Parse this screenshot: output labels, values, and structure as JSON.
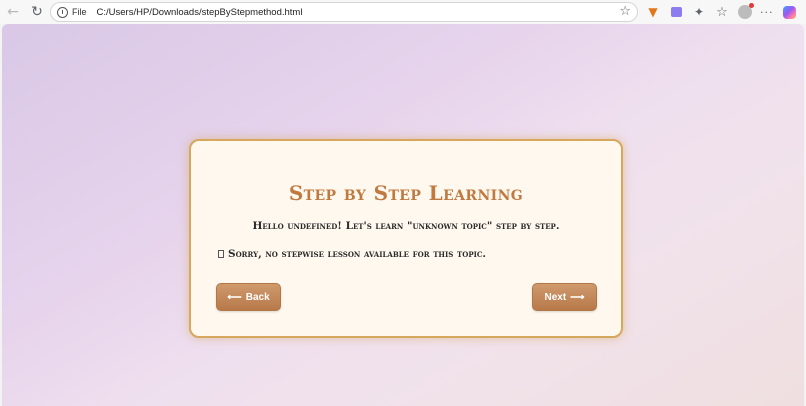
{
  "browser": {
    "file_label": "File",
    "url": "C:/Users/HP/Downloads/stepByStepmethod.html",
    "icons": {
      "back": "back-arrow-icon",
      "reload": "reload-icon",
      "info": "info-icon",
      "favorite": "star-icon",
      "extensions": "puzzle-icon",
      "favorites": "favorites-icon",
      "menu": "more-icon"
    }
  },
  "lesson": {
    "title": "Step by Step Learning",
    "greeting": "Hello undefined! Let's learn \"unknown topic\" step by step.",
    "message": "Sorry, no stepwise lesson available for this topic.",
    "back_label": "Back",
    "next_label": "Next"
  },
  "colors": {
    "accent": "#c0793f",
    "card_border": "#d6a75c",
    "button": "#c08457",
    "card_bg": "#fff8ee"
  }
}
